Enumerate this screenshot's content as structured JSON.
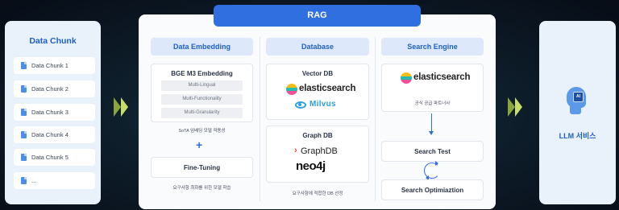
{
  "data_chunk": {
    "title": "Data Chunk",
    "items": [
      "Data Chunk 1",
      "Data Chunk 2",
      "Data Chunk 3",
      "Data Chunk 4",
      "Data Chunk 5",
      "..."
    ]
  },
  "rag": {
    "title": "RAG",
    "embedding": {
      "header": "Data Embedding",
      "model_title": "BGE M3 Embedding",
      "features": [
        "Multi-Lingual",
        "Multi-Functionality",
        "Multi-Granularity"
      ],
      "model_note": "SoTA 임베딩 모델 적용성",
      "plus": "+",
      "finetune_title": "Fine-Tuning",
      "finetune_note": "요구사항 최화를 위한 모델 학습"
    },
    "database": {
      "header": "Database",
      "vector_title": "Vector DB",
      "vector_logos": [
        "elasticsearch",
        "Milvus"
      ],
      "graph_title": "Graph DB",
      "graph_logos": [
        "GraphDB",
        "neo4j"
      ],
      "note": "요구사항에 적합한 DB 선정"
    },
    "search": {
      "header": "Search Engine",
      "logo": "elasticsearch",
      "note": "공식 공급 파트너사",
      "test_title": "Search Test",
      "opt_title": "Search Optimiaztion"
    }
  },
  "llm": {
    "title": "LLM 서비스",
    "chip_label": "AI"
  },
  "colors": {
    "primary": "#2f6fe0",
    "header_bg": "#dde9fb",
    "panel_bg": "#e9f1fb",
    "arrow_dark": "#8aa63a",
    "arrow_light": "#c4dd6b"
  },
  "icons": [
    "document-icon",
    "arrow-right-icon",
    "plus-icon",
    "down-arrow-icon",
    "refresh-cycle-icon",
    "ai-head-icon",
    "elasticsearch-logo",
    "milvus-logo",
    "graphdb-logo",
    "neo4j-logo"
  ]
}
